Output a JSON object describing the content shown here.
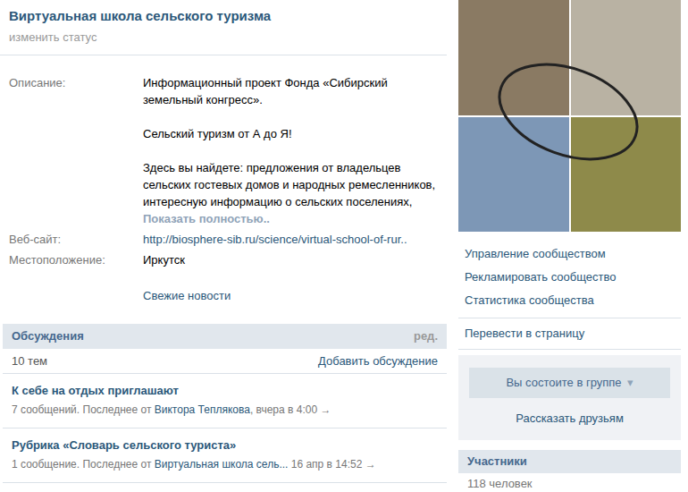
{
  "group": {
    "title": "Виртуальная школа сельского туризма",
    "status_action": "изменить статус"
  },
  "description": {
    "label": "Описание:",
    "paragraphs": [
      "Информационный проект Фонда «Сибирский земельный конгресс».",
      "Сельский туризм от А до Я!",
      "Здесь вы найдете: предложения от владельцев сельских гостевых домов и народных ремесленников, интересную информацию о сельских поселениях,"
    ],
    "more": "Показать полностью.."
  },
  "info_rows": [
    {
      "label": "Веб-сайт:",
      "value": "http://biosphere-sib.ru/science/virtual-school-of-rur..",
      "kind": "link"
    },
    {
      "label": "Местоположение:",
      "value": "Иркутск",
      "kind": "text"
    }
  ],
  "news_link": "Свежие новости",
  "discussions": {
    "title": "Обсуждения",
    "edit": "ред.",
    "count": "10 тем",
    "add": "Добавить обсуждение",
    "topics": [
      {
        "title": "К себе на отдых приглашают",
        "messages": "7 сообщений.",
        "last": "Последнее от",
        "author": "Виктора Теплякова",
        "sep": ",",
        "time": "вчера в 4:00",
        "arrow": "→"
      },
      {
        "title": "Рубрика «Словарь сельского туриста»",
        "messages": "1 сообщение.",
        "last": "Последнее от",
        "author": "Виртуальная школа сель...",
        "sep": "",
        "time": "16 апр в 14:52",
        "arrow": "→"
      }
    ]
  },
  "sidebar": {
    "actions": [
      "Управление сообществом",
      "Рекламировать сообщество",
      "Статистика сообщества"
    ],
    "convert": "Перевести в страницу",
    "member_button": {
      "label": "Вы состоите в группе",
      "caret": "▾"
    },
    "share": "Рассказать друзьям"
  },
  "members": {
    "title": "Участники",
    "count": "118 человек"
  }
}
